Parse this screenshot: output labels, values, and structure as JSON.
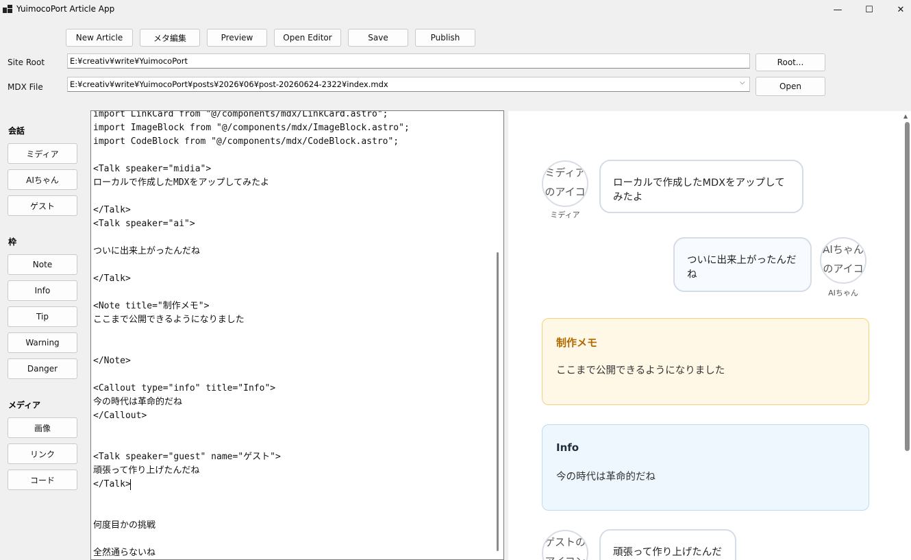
{
  "window": {
    "title": "YuimocoPort Article App",
    "minimize": "—",
    "maximize": "☐",
    "close": "✕"
  },
  "toolbar": {
    "new_article": "New Article",
    "meta_edit": "メタ編集",
    "preview": "Preview",
    "open_editor": "Open Editor",
    "save": "Save",
    "publish": "Publish"
  },
  "site_root": {
    "label": "Site Root",
    "value": "E:¥creativ¥write¥YuimocoPort",
    "button": "Root..."
  },
  "mdx_file": {
    "label": "MDX File",
    "value": "E:¥creativ¥write¥YuimocoPort¥posts¥2026¥06¥post-20260624-2322¥index.mdx",
    "button": "Open"
  },
  "palette": {
    "talk_heading": "会話",
    "talk_buttons": [
      "ミディア",
      "AIちゃん",
      "ゲスト"
    ],
    "frame_heading": "枠",
    "frame_buttons": [
      "Note",
      "Info",
      "Tip",
      "Warning",
      "Danger"
    ],
    "media_heading": "メディア",
    "media_buttons": [
      "画像",
      "リンク",
      "コード"
    ]
  },
  "editor": {
    "lines": [
      {
        "text": "import LinkCard from \"@/components/mdx/LinkCard.astro\";"
      },
      {
        "text": "import ImageBlock from \"@/components/mdx/ImageBlock.astro\";"
      },
      {
        "text": "import CodeBlock from \"@/components/mdx/CodeBlock.astro\";"
      },
      {
        "text": ""
      },
      {
        "text": "<Talk speaker=\"midia\">"
      },
      {
        "text": "ローカルで作成したMDXをアップしてみたよ"
      },
      {
        "text": ""
      },
      {
        "text": "</Talk>"
      },
      {
        "text": "<Talk speaker=\"ai\">"
      },
      {
        "text": ""
      },
      {
        "text": "ついに出来上がったんだね"
      },
      {
        "text": ""
      },
      {
        "text": "</Talk>"
      },
      {
        "text": ""
      },
      {
        "text": "<Note title=\"制作メモ\">"
      },
      {
        "text": "ここまで公開できるようになりました"
      },
      {
        "text": ""
      },
      {
        "text": ""
      },
      {
        "text": "</Note>"
      },
      {
        "text": ""
      },
      {
        "text": "<Callout type=\"info\" title=\"Info\">"
      },
      {
        "text": "今の時代は革命的だね"
      },
      {
        "text": "</Callout>"
      },
      {
        "text": ""
      },
      {
        "text": ""
      },
      {
        "text": "<Talk speaker=\"guest\" name=\"ゲスト\">"
      },
      {
        "text": "頑張って作り上げたんだね"
      },
      {
        "text": "</Talk>"
      },
      {
        "text": ""
      },
      {
        "text": ""
      },
      {
        "text": "何度目かの挑戦"
      },
      {
        "text": ""
      },
      {
        "text": "全然通らないね"
      }
    ]
  },
  "preview": {
    "talk1": {
      "avatar_alt": "ミディアのアイコン",
      "name": "ミディア",
      "text": "ローカルで作成したMDXをアップしてみたよ"
    },
    "talk2": {
      "avatar_alt": "AIちゃんのアイコン",
      "name": "AIちゃん",
      "text": "ついに出来上がったんだね"
    },
    "note": {
      "title": "制作メモ",
      "body": "ここまで公開できるようになりました",
      "bg": "#fff8e6",
      "border": "#f5d27a",
      "title_color": "#b26a00"
    },
    "info": {
      "title": "Info",
      "body": "今の時代は革命的だね",
      "bg": "#eef7fd",
      "border": "#b9dcf2",
      "title_color": "#1f2d3d"
    },
    "talk3": {
      "avatar_alt": "ゲストのアイコン",
      "text": "頑張って作り上げたんだね"
    }
  }
}
